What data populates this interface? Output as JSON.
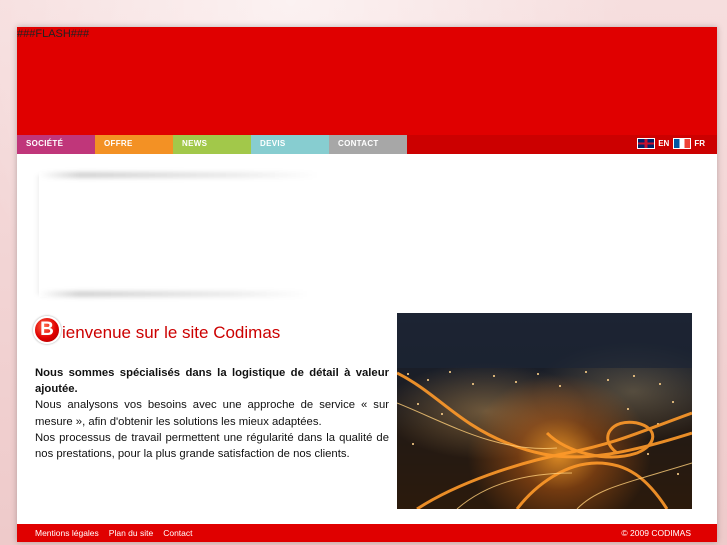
{
  "flash": {
    "placeholder_text": "###FLASH###"
  },
  "nav": {
    "items": [
      {
        "label": "SOCIÉTÉ"
      },
      {
        "label": "OFFRE"
      },
      {
        "label": "NEWS"
      },
      {
        "label": "DEVIS"
      },
      {
        "label": "CONTACT"
      }
    ]
  },
  "languages": [
    {
      "code": "EN",
      "flag_icon": "uk-flag-icon"
    },
    {
      "code": "FR",
      "flag_icon": "france-flag-icon"
    }
  ],
  "welcome": {
    "icon_letter": "B",
    "title": "ienvenue sur le site Codimas"
  },
  "intro": {
    "bold": "Nous sommes spécialisés dans la logistique de détail à valeur ajoutée.",
    "p1": "Nous analysons vos besoins avec une approche de service « sur mesure », afin d'obtenir les solutions les mieux adaptées.",
    "p2": "Nos processus de travail  permettent une régularité dans la qualité de nos prestations, pour la plus grande satisfaction de nos clients."
  },
  "footer": {
    "links": [
      "Mentions légales",
      "Plan du site",
      "Contact"
    ],
    "copyright": "© 2009 CODIMAS"
  },
  "colors": {
    "brand_red": "#e00000",
    "nav_societe": "#c0367a",
    "nav_offre": "#f39124",
    "nav_news": "#a2c84a",
    "nav_devis": "#87cdd0",
    "nav_contact": "#a7a7a7"
  }
}
